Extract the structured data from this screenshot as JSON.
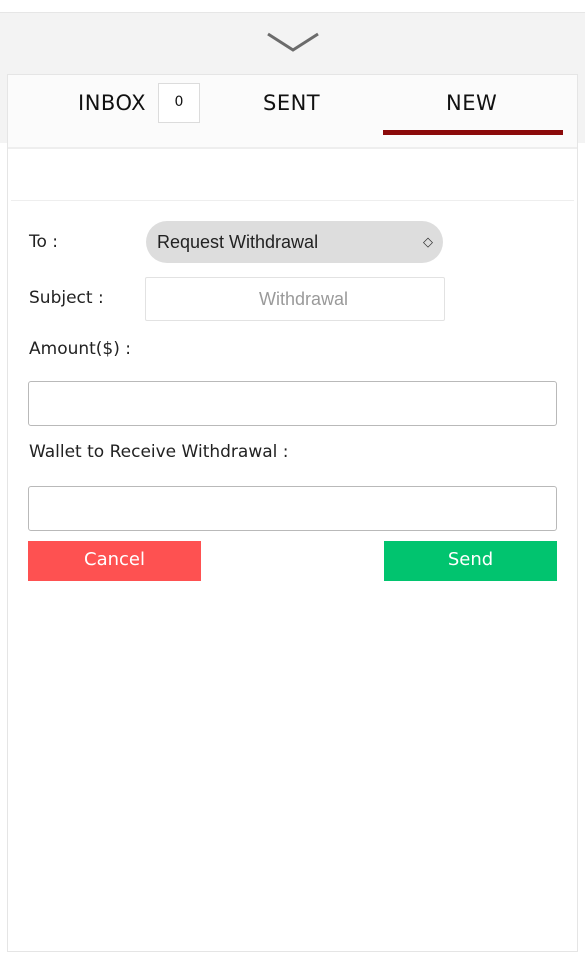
{
  "header": {
    "collapse_icon": "chevron-down-icon"
  },
  "tabs": [
    {
      "label": "INBOX",
      "badge": "0",
      "active": false
    },
    {
      "label": "SENT",
      "active": false
    },
    {
      "label": "NEW",
      "active": true
    }
  ],
  "accent_color": "#8b0a0a",
  "form": {
    "to_label": "To :",
    "to_value": "Request Withdrawal",
    "subject_label": "Subject :",
    "subject_value": "Withdrawal",
    "amount_label": "Amount($) :",
    "amount_value": "",
    "wallet_label": "Wallet to Receive Withdrawal :",
    "wallet_value": ""
  },
  "buttons": {
    "cancel": {
      "label": "Cancel",
      "color": "#fe5151"
    },
    "send": {
      "label": "Send",
      "color": "#01c46f"
    }
  }
}
